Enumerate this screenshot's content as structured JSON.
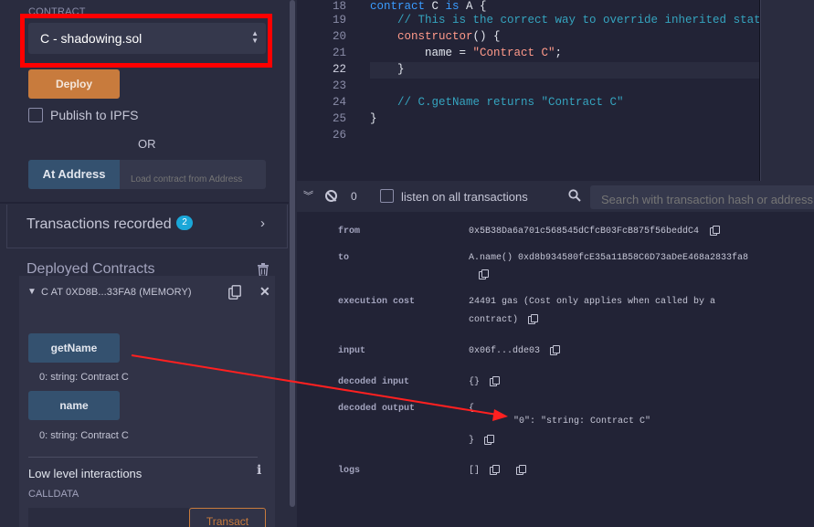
{
  "deploy_panel": {
    "contract_label": "CONTRACT",
    "contract_select_value": "C - shadowing.sol",
    "deploy_label": "Deploy",
    "publish_ipfs_label": "Publish to IPFS",
    "or_label": "OR",
    "at_address_label": "At Address",
    "address_placeholder": "Load contract from Address"
  },
  "transactions": {
    "label": "Transactions recorded",
    "count": "2"
  },
  "deployed": {
    "title": "Deployed Contracts",
    "instance_title": "C AT 0XD8B...33FA8 (MEMORY)",
    "functions": [
      {
        "label": "getName",
        "result": "0: string: Contract C"
      },
      {
        "label": "name",
        "result": "0: string: Contract C"
      }
    ],
    "low_level_label": "Low level interactions",
    "calldata_label": "CALLDATA",
    "transact_label": "Transact"
  },
  "editor": {
    "lines": [
      {
        "num": "18",
        "active": false,
        "tokens": [
          {
            "t": "contract ",
            "c": "kw"
          },
          {
            "t": "C ",
            "c": "tx"
          },
          {
            "t": "is ",
            "c": "kw"
          },
          {
            "t": "A {",
            "c": "tx"
          }
        ]
      },
      {
        "num": "19",
        "active": false,
        "tokens": [
          {
            "t": "    // This is the correct way to override inherited state variables.",
            "c": "cm"
          }
        ]
      },
      {
        "num": "20",
        "active": false,
        "tokens": [
          {
            "t": "    ",
            "c": "tx"
          },
          {
            "t": "constructor",
            "c": "fn"
          },
          {
            "t": "() {",
            "c": "tx"
          }
        ]
      },
      {
        "num": "21",
        "active": false,
        "tokens": [
          {
            "t": "        name = ",
            "c": "tx"
          },
          {
            "t": "\"Contract C\"",
            "c": "st"
          },
          {
            "t": ";",
            "c": "tx"
          }
        ]
      },
      {
        "num": "22",
        "active": true,
        "tokens": [
          {
            "t": "    }",
            "c": "tx"
          }
        ]
      },
      {
        "num": "23",
        "active": false,
        "tokens": []
      },
      {
        "num": "24",
        "active": false,
        "tokens": [
          {
            "t": "    // C.getName returns \"Contract C\"",
            "c": "cm"
          }
        ]
      },
      {
        "num": "25",
        "active": false,
        "tokens": [
          {
            "t": "}",
            "c": "tx"
          }
        ]
      },
      {
        "num": "26",
        "active": false,
        "tokens": []
      }
    ]
  },
  "terminal": {
    "count": "0",
    "listen_label": "listen on all transactions",
    "search_placeholder": "Search with transaction hash or address",
    "details": {
      "from_key": "from",
      "from_val": "0x5B38Da6a701c568545dCfcB03FcB875f56beddC4",
      "to_key": "to",
      "to_val": "A.name() 0xd8b934580fcE35a11B58C6D73aDeE468a2833fa8",
      "cost_key": "execution cost",
      "cost_val_1": "24491 gas (Cost only applies when called by a",
      "cost_val_2": "contract)",
      "input_key": "input",
      "input_val": "0x06f...dde03",
      "decoded_input_key": "decoded input",
      "decoded_input_val": "{}",
      "decoded_output_key": "decoded output",
      "decoded_output_open": "{",
      "decoded_output_entry": "\"0\": \"string: Contract C\"",
      "decoded_output_close": "}",
      "logs_key": "logs",
      "logs_val": "[]"
    }
  },
  "colors": {
    "annotation": "#ff0000",
    "deploy_button": "#c87b3d",
    "function_button": "#34516f",
    "badge": "#1aa7d8"
  }
}
